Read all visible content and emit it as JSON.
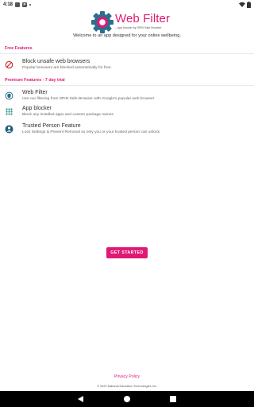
{
  "status_bar": {
    "time": "4:18",
    "icons": [
      "notification-square-icon",
      "p-badge-icon",
      "dot-icon",
      "wifi-icon",
      "battery-icon"
    ]
  },
  "app": {
    "brand": "Web Filter",
    "brand_sub": "– App blocker by SPIN Safe Browser",
    "welcome": "Welcome to an app designed for your online wellbeing."
  },
  "free_section": {
    "title": "Free Features",
    "items": [
      {
        "icon": "block-icon",
        "title": "Block unsafe web browsers",
        "desc": "Popular browsers are blocked automatically for free."
      }
    ]
  },
  "premium_section": {
    "title": "Premium Features - 7 day trial",
    "items": [
      {
        "icon": "shield-icon",
        "title": "Web Filter",
        "desc": "Use our filtering from SPIN Safe Browser with Google's popular web browser"
      },
      {
        "icon": "apps-grid-icon",
        "title": "App blocker",
        "desc": "Block any installed apps and custom package names"
      },
      {
        "icon": "trusted-person-icon",
        "title": "Trusted Person Feature",
        "desc": "Lock Settings & Prevent Removal so only you or your trusted person can unlock."
      }
    ]
  },
  "cta": {
    "label": "GET STARTED"
  },
  "footer": {
    "privacy": "Privacy Policy",
    "copyright": "© 2023 National Education Technologies Inc."
  },
  "colors": {
    "accent": "#e01a74",
    "gear_outer": "#2a6f8f",
    "gear_inner": "#e01a74"
  }
}
